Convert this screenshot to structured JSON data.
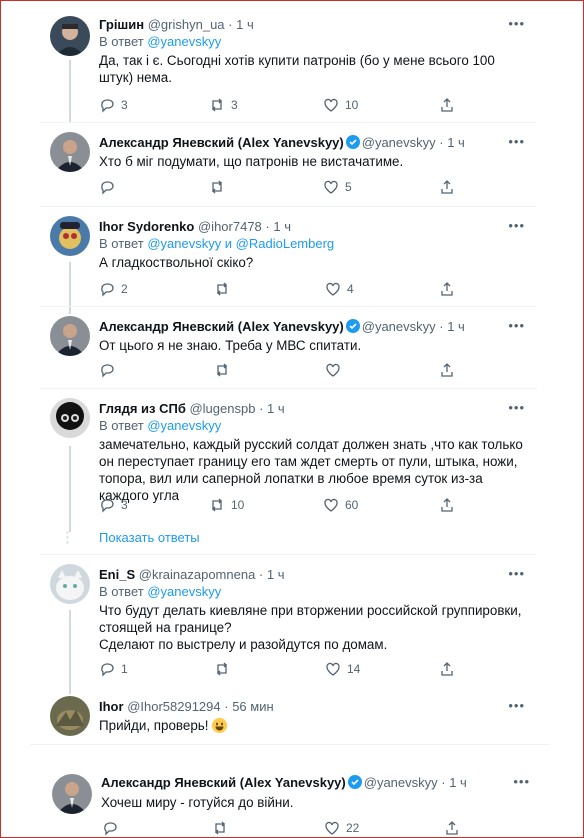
{
  "tweets": [
    {
      "name": "Грішин",
      "handle": "@grishyn_ua",
      "time": "· 1 ч",
      "reply_prefix": "В ответ ",
      "reply_to": "@yanevskyy",
      "text": "Да, так і є. Сьогодні хотів купити патронів (бо у мене всього 100 штук) нема.",
      "replies": "3",
      "retweets": "3",
      "likes": "10"
    },
    {
      "name": "Александр Яневский (Alex Yanevskyy)",
      "handle": "@yanevskyy",
      "time": "· 1 ч",
      "text": "Хто б міг подумати, що патронів не вистачатиме.",
      "replies": "",
      "retweets": "",
      "likes": "5"
    },
    {
      "name": "Ihor Sydorenko",
      "handle": "@ihor7478",
      "time": "· 1 ч",
      "reply_prefix": "В ответ ",
      "reply_to": "@yanevskyy и @RadioLemberg",
      "text": "А гладкоствольної скіко?",
      "replies": "2",
      "retweets": "",
      "likes": "4"
    },
    {
      "name": "Александр Яневский (Alex Yanevskyy)",
      "handle": "@yanevskyy",
      "time": "· 1 ч",
      "text": "От цього я не знаю. Треба у МВС спитати.",
      "replies": "",
      "retweets": "",
      "likes": ""
    },
    {
      "name": "Глядя из СПб",
      "handle": "@lugenspb",
      "time": "· 1 ч",
      "reply_prefix": "В ответ ",
      "reply_to": "@yanevskyy",
      "text": "замечательно, каждый русский солдат должен знать ,что как только он переступает границу его там ждет смерть от пули, штыка, ножи, топора, вил или саперной лопатки в любое время суток из-за каждого угла",
      "replies": "3",
      "retweets": "10",
      "likes": "60"
    },
    {
      "name": "Eni_S",
      "handle": "@krainazapomnena",
      "time": "· 1 ч",
      "reply_prefix": "В ответ ",
      "reply_to": "@yanevskyy",
      "text": "Что будут делать киевляне при вторжении российской группировки, стоящей на границе?",
      "text2": "Сделают по выстрелу и разойдутся по домам.",
      "replies": "1",
      "retweets": "",
      "likes": "14"
    },
    {
      "name": "Ihor",
      "handle": "@Ihor58291294",
      "time": "· 56 мин",
      "text": "Прийди, проверь!"
    },
    {
      "name": "Александр Яневский (Alex Yanevskyy)",
      "handle": "@yanevskyy",
      "time": "· 1 ч",
      "text": "Хочеш миру - готуйся до війни.",
      "replies": "",
      "retweets": "",
      "likes": "22"
    }
  ],
  "show_replies": "Показать ответы",
  "colors": {
    "accent": "#1d9bf0",
    "muted": "#536471",
    "frame": "#c9302c"
  }
}
